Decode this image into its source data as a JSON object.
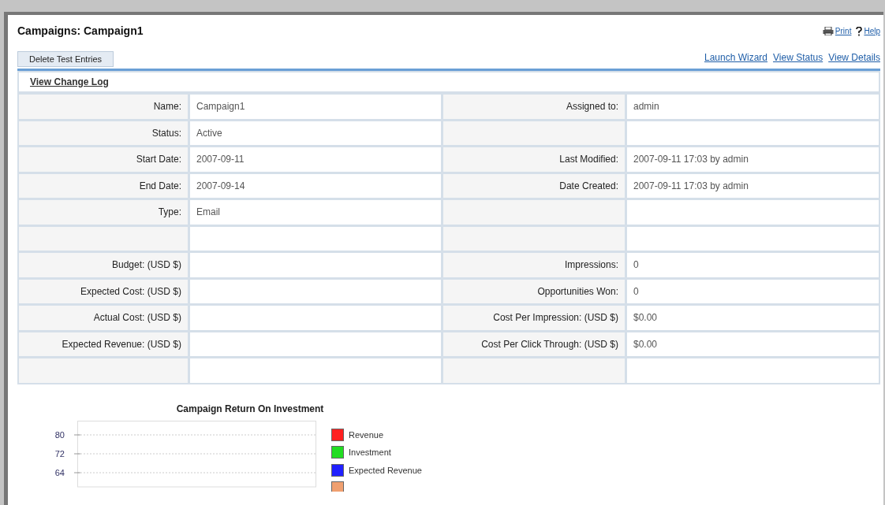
{
  "page": {
    "title": "Campaigns: Campaign1",
    "links": [
      {
        "kind": "print",
        "label": "Print"
      },
      {
        "kind": "help",
        "label": "Help"
      }
    ]
  },
  "toolbar": {
    "button": "Delete Test Entries",
    "links": [
      "Launch Wizard",
      "View Status",
      "View Details"
    ]
  },
  "change_log_link": "View Change Log",
  "rows": [
    {
      "left": {
        "label": "Name:",
        "value": "Campaign1"
      },
      "right": {
        "label": "Assigned to:",
        "value": "admin"
      }
    },
    {
      "left": {
        "label": "Status:",
        "value": "Active"
      },
      "right": {}
    },
    {
      "left": {
        "label": "Start Date:",
        "value": "2007-09-11"
      },
      "right": {
        "label": "Last Modified:",
        "value": "2007-09-11 17:03 by admin"
      }
    },
    {
      "left": {
        "label": "End Date:",
        "value": "2007-09-14"
      },
      "right": {
        "label": "Date Created:",
        "value": "2007-09-11 17:03 by admin"
      }
    },
    {
      "left": {
        "label": "Type:",
        "value": "Email"
      },
      "right": {}
    },
    {
      "left": {},
      "right": {}
    },
    {
      "left": {
        "label": "Budget: (USD $)"
      },
      "right": {
        "label": "Impressions:",
        "value": "0"
      }
    },
    {
      "left": {
        "label": "Expected Cost: (USD $)"
      },
      "right": {
        "label": "Opportunities Won:",
        "value": "0"
      }
    },
    {
      "left": {
        "label": "Actual Cost: (USD $)"
      },
      "right": {
        "label": "Cost Per Impression: (USD $)",
        "value": "$0.00"
      }
    },
    {
      "left": {
        "label": "Expected Revenue: (USD $)"
      },
      "right": {
        "label": "Cost Per Click Through: (USD $)",
        "value": "$0.00"
      }
    },
    {
      "left": {},
      "right": {}
    }
  ],
  "chart": {
    "chart_data": {
      "type": "bar",
      "title": "Campaign Return On Investment",
      "ylim": [
        58,
        86
      ],
      "grid": true,
      "yticks": [
        80,
        72,
        64
      ],
      "series": [
        {
          "name": "Revenue",
          "color": "#ff2020"
        },
        {
          "name": "Investment",
          "color": "#22dd22"
        },
        {
          "name": "Expected Revenue",
          "color": "#2020ff"
        },
        {
          "color": "#f0a070"
        }
      ]
    }
  }
}
